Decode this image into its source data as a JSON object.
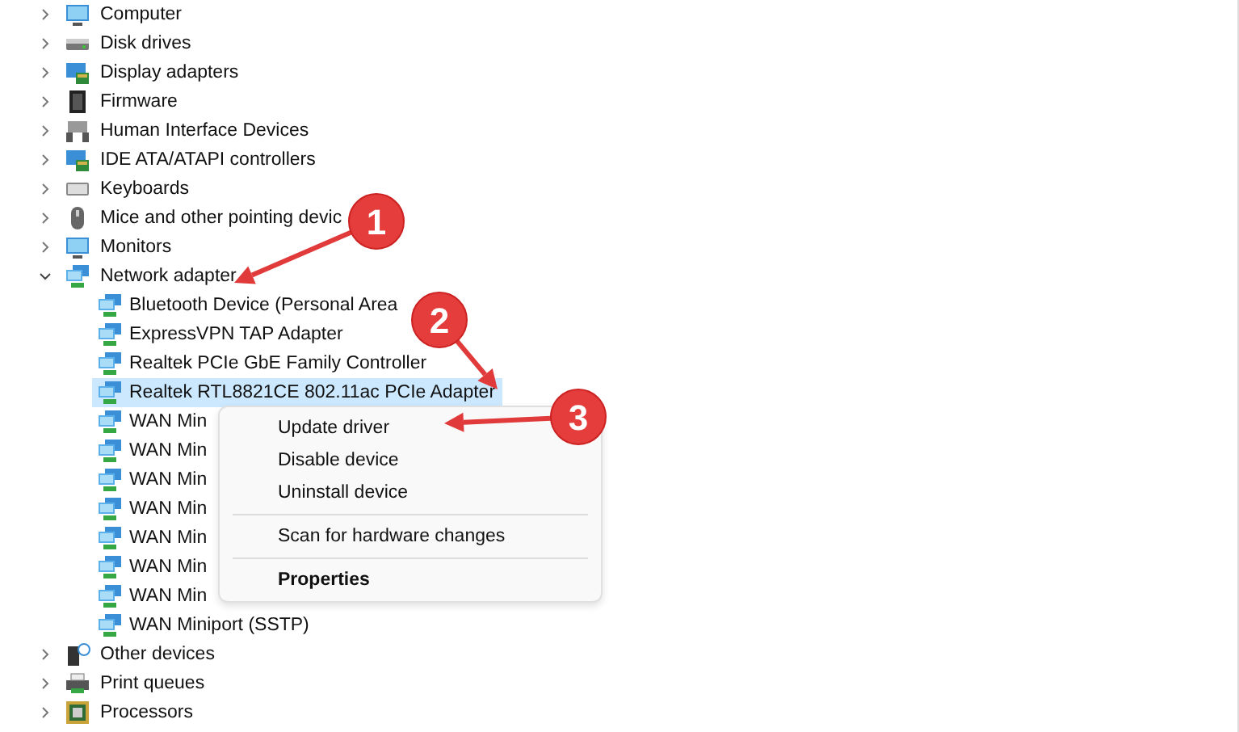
{
  "tree": [
    {
      "label": "Computer",
      "kind": "monitor",
      "expanded": false
    },
    {
      "label": "Disk drives",
      "kind": "disk",
      "expanded": false
    },
    {
      "label": "Display adapters",
      "kind": "display",
      "expanded": false
    },
    {
      "label": "Firmware",
      "kind": "chip",
      "expanded": false
    },
    {
      "label": "Human Interface Devices",
      "kind": "hid",
      "expanded": false
    },
    {
      "label": "IDE ATA/ATAPI controllers",
      "kind": "display",
      "expanded": false
    },
    {
      "label": "Keyboards",
      "kind": "keyboard",
      "expanded": false
    },
    {
      "label": "Mice and other pointing devic",
      "kind": "mouse",
      "expanded": false
    },
    {
      "label": "Monitors",
      "kind": "monitor",
      "expanded": false
    },
    {
      "label": "Network adapter",
      "kind": "network",
      "expanded": true,
      "children": [
        {
          "label": "Bluetooth Device (Personal Area",
          "selected": false
        },
        {
          "label": "ExpressVPN TAP Adapter",
          "selected": false
        },
        {
          "label": "Realtek PCIe GbE Family Controller",
          "selected": false
        },
        {
          "label": "Realtek RTL8821CE 802.11ac PCIe Adapter",
          "selected": true
        },
        {
          "label": "WAN Min",
          "selected": false
        },
        {
          "label": "WAN Min",
          "selected": false
        },
        {
          "label": "WAN Min",
          "selected": false
        },
        {
          "label": "WAN Min",
          "selected": false
        },
        {
          "label": "WAN Min",
          "selected": false
        },
        {
          "label": "WAN Min",
          "selected": false
        },
        {
          "label": "WAN Min",
          "selected": false
        },
        {
          "label": "WAN Miniport (SSTP)",
          "selected": false
        }
      ]
    },
    {
      "label": "Other devices",
      "kind": "other",
      "expanded": false
    },
    {
      "label": "Print queues",
      "kind": "printer",
      "expanded": false
    },
    {
      "label": "Processors",
      "kind": "processor",
      "expanded": false
    }
  ],
  "context_menu": [
    {
      "label": "Update driver",
      "kind": "item"
    },
    {
      "label": "Disable device",
      "kind": "item"
    },
    {
      "label": "Uninstall device",
      "kind": "item"
    },
    {
      "kind": "separator"
    },
    {
      "label": "Scan for hardware changes",
      "kind": "item"
    },
    {
      "kind": "separator"
    },
    {
      "label": "Properties",
      "kind": "default"
    }
  ],
  "annotations": [
    {
      "label": "1"
    },
    {
      "label": "2"
    },
    {
      "label": "3"
    }
  ]
}
